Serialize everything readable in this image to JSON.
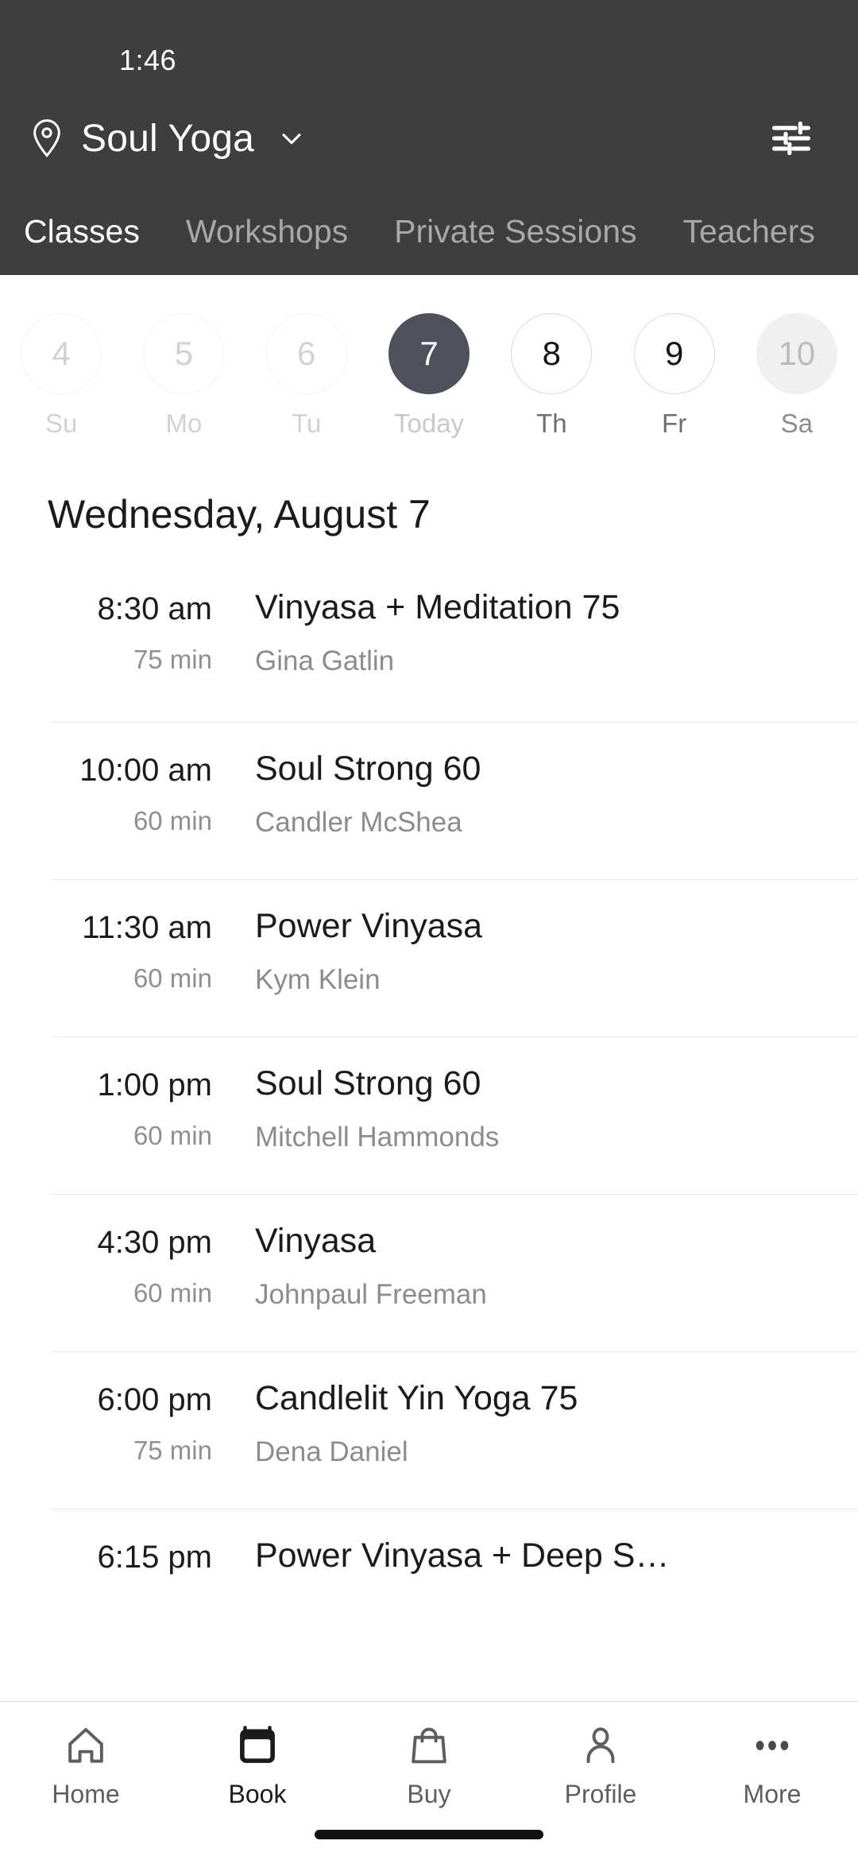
{
  "status": {
    "time": "1:46"
  },
  "header": {
    "location_name": "Soul Yoga",
    "pin_icon": "location-pin-icon",
    "chevron_icon": "chevron-down-icon",
    "filter_icon": "filter-sliders-icon",
    "background_color": "#3e3e3e",
    "tabs": [
      {
        "label": "Classes",
        "active": true
      },
      {
        "label": "Workshops",
        "active": false
      },
      {
        "label": "Private Sessions",
        "active": false
      },
      {
        "label": "Teachers",
        "active": false
      }
    ]
  },
  "date_strip": {
    "days": [
      {
        "num": "4",
        "label": "Su",
        "state": "past"
      },
      {
        "num": "5",
        "label": "Mo",
        "state": "past"
      },
      {
        "num": "6",
        "label": "Tu",
        "state": "past"
      },
      {
        "num": "7",
        "label": "Today",
        "state": "today"
      },
      {
        "num": "8",
        "label": "Th",
        "state": "avail"
      },
      {
        "num": "9",
        "label": "Fr",
        "state": "avail"
      },
      {
        "num": "10",
        "label": "Sa",
        "state": "pressed"
      }
    ],
    "selected_color": "#4d525d"
  },
  "schedule": {
    "day_heading": "Wednesday, August 7",
    "classes": [
      {
        "time": "8:30 am",
        "duration": "75 min",
        "name": "Vinyasa + Meditation 75",
        "teacher": "Gina Gatlin"
      },
      {
        "time": "10:00 am",
        "duration": "60 min",
        "name": "Soul Strong 60",
        "teacher": "Candler McShea"
      },
      {
        "time": "11:30 am",
        "duration": "60 min",
        "name": "Power Vinyasa",
        "teacher": "Kym Klein"
      },
      {
        "time": "1:00 pm",
        "duration": "60 min",
        "name": "Soul Strong 60",
        "teacher": "Mitchell Hammonds"
      },
      {
        "time": "4:30 pm",
        "duration": "60 min",
        "name": "Vinyasa",
        "teacher": "Johnpaul Freeman"
      },
      {
        "time": "6:00 pm",
        "duration": "75 min",
        "name": "Candlelit Yin Yoga 75",
        "teacher": "Dena Daniel"
      },
      {
        "time": "6:15 pm",
        "duration": "",
        "name": "Power Vinyasa + Deep S…",
        "teacher": ""
      }
    ]
  },
  "bottom_nav": {
    "items": [
      {
        "label": "Home",
        "icon": "home-icon",
        "active": false
      },
      {
        "label": "Book",
        "icon": "calendar-icon",
        "active": true
      },
      {
        "label": "Buy",
        "icon": "shopping-bag-icon",
        "active": false
      },
      {
        "label": "Profile",
        "icon": "person-icon",
        "active": false
      },
      {
        "label": "More",
        "icon": "more-dots-icon",
        "active": false
      }
    ]
  }
}
